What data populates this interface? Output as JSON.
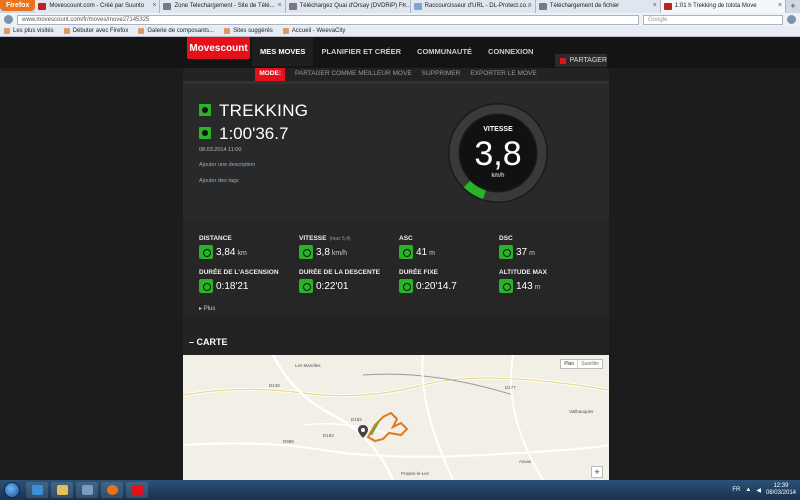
{
  "browser": {
    "menu_button": "Firefox",
    "tabs": [
      {
        "title": "Movescount.com - Créé par Suunto",
        "active": false
      },
      {
        "title": "Zone Telechargement - Site de Télé...",
        "active": false
      },
      {
        "title": "Téléchargez Quai d'Orsay (DVDRiP) Fr...",
        "active": false
      },
      {
        "title": "Raccourcisseur d'URL - DL-Protect.co...",
        "active": false
      },
      {
        "title": "Téléchargement de fichier",
        "active": false
      },
      {
        "title": "1:01 h Trekking de tolsta Move",
        "active": true
      }
    ],
    "url": "www.movescount.com/fr/moves/move27145325",
    "search_placeholder": "Google",
    "bookmarks": [
      "Les plus visités",
      "Débuter avec Firefox",
      "Galerie de composants...",
      "Sites suggérés",
      "Accueil - WeevaCity"
    ]
  },
  "site": {
    "logo": "Movescount",
    "nav": [
      "MES MOVES",
      "PLANIFIER ET CRÉER",
      "COMMUNAUTÉ",
      "CONNEXION"
    ],
    "share": "PARTAGER"
  },
  "subnav": [
    "MODE:",
    "PARTAGER COMME MEILLEUR MOVE",
    "SUPPRIMER",
    "EXPORTER LE MOVE"
  ],
  "move": {
    "activity": "TREKKING",
    "duration": "1:00'36.7",
    "date": "08.03.2014 11:00",
    "add_description": "Ajouter une description",
    "add_tags": "Ajouter des tags"
  },
  "gauge": {
    "label": "VITESSE",
    "value": "3,8",
    "unit": "km/h",
    "fill_fraction": 0.1
  },
  "stats": [
    {
      "label": "DISTANCE",
      "extra": "",
      "value": "3,84",
      "unit": "km"
    },
    {
      "label": "VITESSE",
      "extra": "(max 5,4)",
      "value": "3,8",
      "unit": "km/h"
    },
    {
      "label": "ASC",
      "extra": "",
      "value": "41",
      "unit": "m"
    },
    {
      "label": "DSC",
      "extra": "",
      "value": "37",
      "unit": "m"
    },
    {
      "label": "DURÉE DE L'ASCENSION",
      "extra": "",
      "value": "0:18'21",
      "unit": ""
    },
    {
      "label": "DURÉE DE LA DESCENTE",
      "extra": "",
      "value": "0:22'01",
      "unit": ""
    },
    {
      "label": "DURÉE FIXE",
      "extra": "",
      "value": "0:20'14.7",
      "unit": ""
    },
    {
      "label": "ALTITUDE MAX",
      "extra": "",
      "value": "143",
      "unit": "m"
    }
  ],
  "more": "Plus",
  "map": {
    "section_title": "CARTE",
    "btn_plan": "Plan",
    "btn_satellite": "Satellite",
    "zoom": "+",
    "labels": [
      "Les Marelles",
      "D177",
      "D140",
      "D182",
      "D183",
      "Prades-le-Lez",
      "Vailhauquès",
      "Assas",
      "D986"
    ]
  },
  "taskbar": {
    "lang": "FR",
    "time": "12:39",
    "date": "08/03/2014"
  },
  "colors": {
    "accent_red": "#e4111b",
    "accent_green": "#29b427"
  }
}
